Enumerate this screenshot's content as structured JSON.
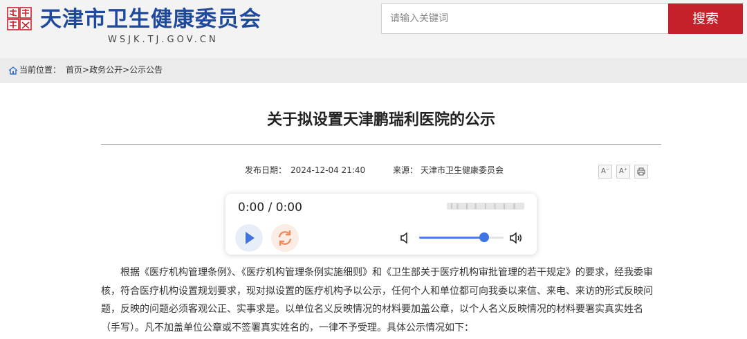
{
  "header": {
    "emblem_text": "天津 卫生",
    "site_title": "天津市卫生健康委员会",
    "site_domain": "WSJK.TJ.GOV.CN"
  },
  "search": {
    "placeholder": "请输入关键词",
    "button_label": "搜索"
  },
  "breadcrumb": {
    "label": "当前位置：",
    "items": [
      "首页",
      "政务公开",
      "公示公告"
    ],
    "separator": ">"
  },
  "article": {
    "title": "关于拟设置天津鹏瑞利医院的公示",
    "date_label": "发布日期：",
    "date": "2024-12-04 21:40",
    "source_label": "来源：",
    "source": "天津市卫生健康委员会",
    "paragraph": "根据《医疗机构管理条例》、《医疗机构管理条例实施细则》和《卫生部关于医疗机构审批管理的若干规定》的要求，经我委审核，符合医疗机构设置规划要求，现对拟设置的医疗机构予以公示，任何个人和单位都可向我委以来信、来电、来访的形式反映问题，反映的问题必须客观公正、实事求是。以单位名义反映情况的材料要加盖公章，以个人名义反映情况的材料要署实真实姓名（手写）。凡不加盖单位公章或不签署真实姓名的，一律不予受理。具体公示情况如下："
  },
  "tools": {
    "font_decrease": "A⁻",
    "font_increase": "A⁺",
    "print_icon": "printer-icon"
  },
  "player": {
    "time": "0:00 / 0:00",
    "volume": 0.77,
    "colors": {
      "accent": "#3f74e2",
      "loop": "#f08a5d"
    }
  },
  "colors": {
    "brand_blue": "#1f4a9c",
    "search_red": "#c5212b",
    "emblem_red": "#c5212b"
  }
}
